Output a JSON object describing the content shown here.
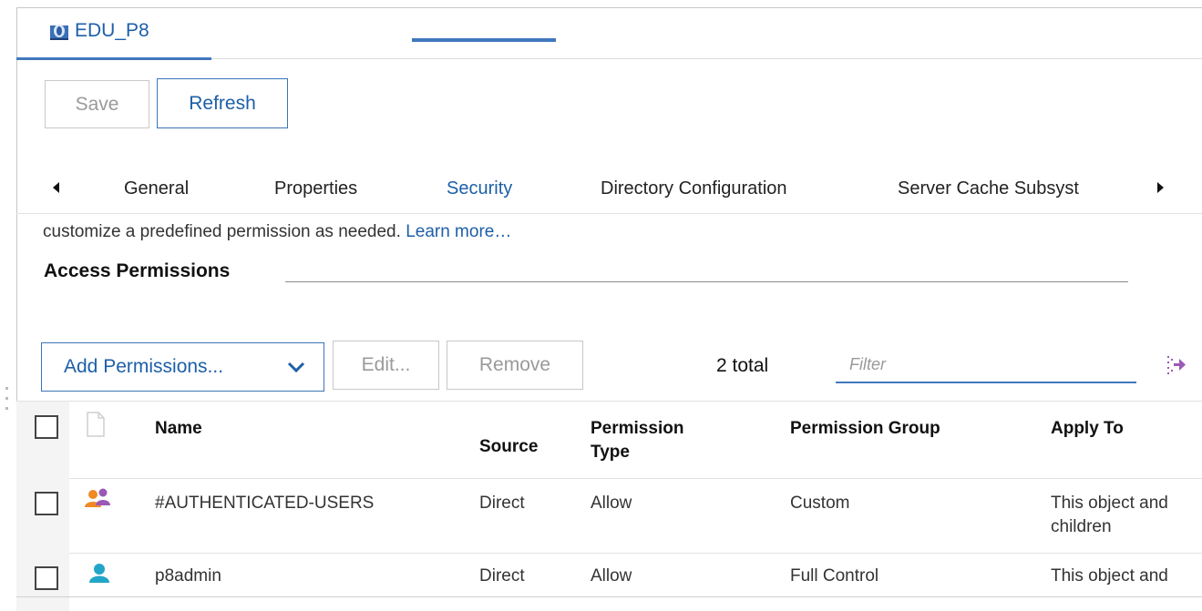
{
  "doc_tab": {
    "label": "EDU_P8",
    "icon": "object-store-icon"
  },
  "toolbar": {
    "save_label": "Save",
    "refresh_label": "Refresh"
  },
  "tabs": [
    {
      "label": "General"
    },
    {
      "label": "Properties"
    },
    {
      "label": "Security",
      "active": true
    },
    {
      "label": "Directory Configuration"
    },
    {
      "label": "Server Cache Subsyst"
    }
  ],
  "description": {
    "text": "customize a predefined permission as needed. ",
    "link": "Learn more…"
  },
  "section": {
    "title": "Access Permissions"
  },
  "perm_toolbar": {
    "add_label": "Add Permissions...",
    "edit_label": "Edit...",
    "remove_label": "Remove",
    "total": "2 total",
    "filter_placeholder": "Filter"
  },
  "table": {
    "headers": {
      "name": "Name",
      "source": "Source",
      "perm_type_1": "Permission",
      "perm_type_2": "Type",
      "perm_group": "Permission Group",
      "apply_to": "Apply To"
    },
    "rows": [
      {
        "icon": "group-icon",
        "name": "#AUTHENTICATED-USERS",
        "source": "Direct",
        "type": "Allow",
        "group": "Custom",
        "apply_1": "This object and",
        "apply_2": "children"
      },
      {
        "icon": "user-icon",
        "name": "p8admin",
        "source": "Direct",
        "type": "Allow",
        "group": "Full Control",
        "apply_1": "This object and",
        "apply_2": ""
      }
    ]
  },
  "colors": {
    "accent": "#4178be",
    "link": "#1d5fa8"
  }
}
